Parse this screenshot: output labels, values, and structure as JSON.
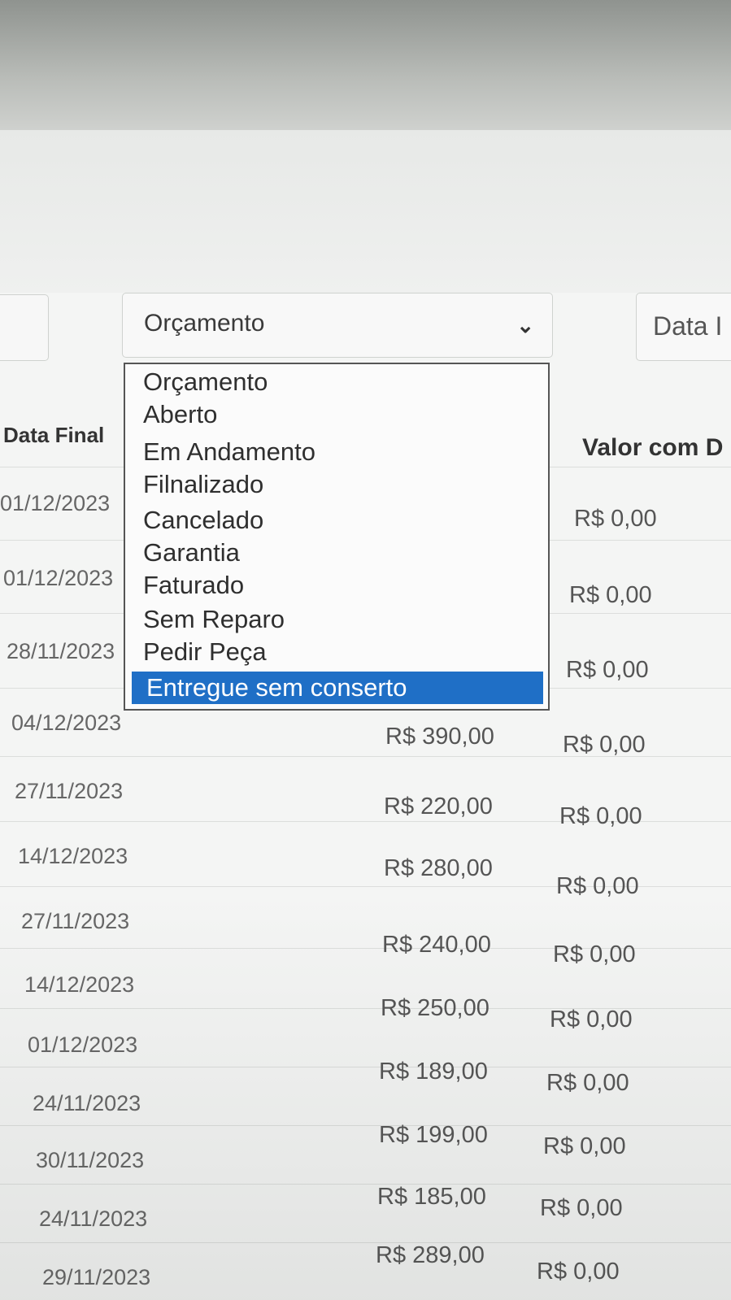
{
  "filters": {
    "status_selected": "Orçamento",
    "date_placeholder": "Data I"
  },
  "dropdown": {
    "options": [
      "Orçamento",
      "Aberto",
      "Em Andamento",
      "Filnalizado",
      "Cancelado",
      "Garantia",
      "Faturado",
      "Sem Reparo",
      "Pedir Peça",
      "Entregue sem conserto"
    ],
    "highlighted_index": 9
  },
  "table": {
    "headers": {
      "data_final": "Data Final",
      "valor_com_desconto": "Valor com D"
    },
    "rows": [
      {
        "data_final": "01/12/2023",
        "valor_com_desconto": "R$ 0,00"
      },
      {
        "data_final": "01/12/2023",
        "valor_com_desconto": "R$ 0,00"
      },
      {
        "data_final": "28/11/2023",
        "valor_com_desconto": "R$ 0,00"
      },
      {
        "data_final": "04/12/2023",
        "valor": "R$ 390,00",
        "valor_com_desconto": "R$ 0,00"
      },
      {
        "data_final": "27/11/2023",
        "valor": "R$ 220,00",
        "valor_com_desconto": "R$ 0,00"
      },
      {
        "data_final": "14/12/2023",
        "valor": "R$ 280,00",
        "valor_com_desconto": "R$ 0,00"
      },
      {
        "data_final": "27/11/2023",
        "valor": "R$ 240,00",
        "valor_com_desconto": "R$ 0,00"
      },
      {
        "data_final": "14/12/2023",
        "valor": "R$ 250,00",
        "valor_com_desconto": "R$ 0,00"
      },
      {
        "data_final": "01/12/2023",
        "valor": "R$ 189,00",
        "valor_com_desconto": "R$ 0,00"
      },
      {
        "data_final": "24/11/2023",
        "valor": "R$ 199,00",
        "valor_com_desconto": "R$ 0,00"
      },
      {
        "data_final": "30/11/2023",
        "valor": "R$ 185,00",
        "valor_com_desconto": "R$ 0,00"
      },
      {
        "data_final": "24/11/2023",
        "valor": "R$ 289,00",
        "valor_com_desconto": "R$ 0,00"
      },
      {
        "data_final": "29/11/2023"
      }
    ]
  },
  "icons": {
    "status_select_arrow": "chevron-down-icon"
  }
}
